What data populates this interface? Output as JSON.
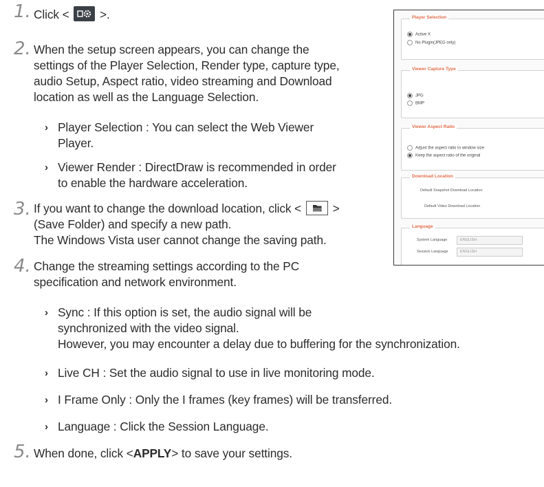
{
  "steps": [
    {
      "num": "1.",
      "before": "Click <",
      "after": ">."
    },
    {
      "num": "2.",
      "lines": [
        "When the setup screen appears, you can change the",
        "settings of the Player Selection, Render type, capture type,",
        "audio Setup, Aspect ratio, video streaming and Download",
        "location as well as the Language Selection."
      ]
    },
    {
      "num": "3.",
      "line1_before": "If you want to change the download location, click <",
      "line1_after": ">",
      "lines": [
        "(Save Folder) and specify a new path.",
        "The Windows Vista user cannot change the saving path."
      ]
    },
    {
      "num": "4.",
      "lines": [
        "Change the streaming settings according to the PC",
        "specification and network environment."
      ]
    },
    {
      "num": "5.",
      "before": "When done, click <",
      "bold": "APPLY",
      "after": "> to save your settings."
    }
  ],
  "bullets_step2": [
    {
      "lines": [
        "Player Selection : You can select the Web Viewer",
        "Player."
      ]
    },
    {
      "lines": [
        "Viewer Render : DirectDraw is recommended in order",
        "to enable the hardware acceleration."
      ]
    }
  ],
  "bullets_step4": [
    {
      "lines": [
        "Sync : If this option is set, the audio signal will be",
        "synchronized with the video signal.",
        "However, you may encounter a delay due to buffering for the synchronization."
      ]
    },
    {
      "lines": [
        "Live CH : Set the audio signal to use in live monitoring mode."
      ]
    },
    {
      "lines": [
        "I Frame Only : Only the I frames (key frames) will be transferred."
      ]
    },
    {
      "lines": [
        "Language : Click the Session Language."
      ]
    }
  ],
  "bullet_glyph": "›",
  "icons": {
    "setup": "gear-icon",
    "folder": "folder-icon"
  },
  "panel": {
    "player_selection": {
      "title": "Player Selection",
      "options": [
        "Active X",
        "No Plugin(JPEG only)"
      ]
    },
    "capture_type": {
      "title": "Viewer Capture Type",
      "options": [
        "JPG",
        "BMP"
      ]
    },
    "aspect_ratio": {
      "title": "Viewer Aspect Ratio",
      "options": [
        "Adjust the aspect ratio to window size",
        "Keep the aspect ratio of the original"
      ]
    },
    "download_location": {
      "title": "Download Location",
      "labels": [
        "Default Snapshot Download Location",
        "Default Video Download Location"
      ]
    },
    "language": {
      "title": "Language",
      "labels": [
        "System Language",
        "Session Language"
      ],
      "values": [
        "ENGLISH",
        "ENGLISH"
      ]
    }
  },
  "colors": {
    "accent": "#e06b48",
    "step_number": "#8a8a8a"
  }
}
